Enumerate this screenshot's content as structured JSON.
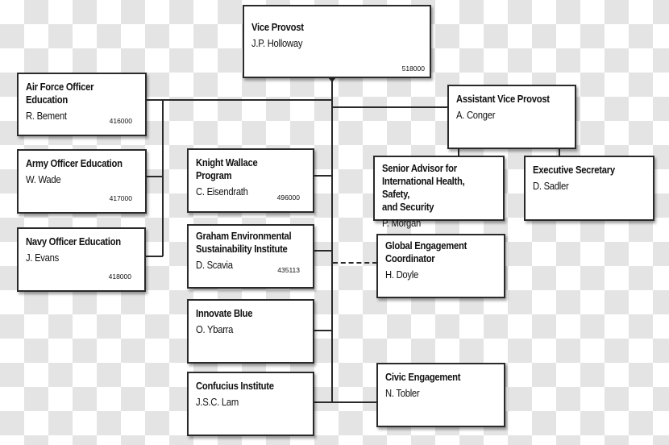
{
  "chart": {
    "vice_provost": {
      "title": "Vice Provost",
      "name": "J.P. Holloway",
      "code": "518000"
    },
    "air_force": {
      "title": "Air Force Officer Education",
      "name": "R. Bement",
      "code": "416000"
    },
    "army": {
      "title": "Army Officer Education",
      "name": "W. Wade",
      "code": "417000"
    },
    "navy": {
      "title": "Navy Officer Education",
      "name": "J. Evans",
      "code": "418000"
    },
    "knight_wallace": {
      "title": "Knight Wallace Program",
      "name": "C. Eisendrath",
      "code": "496000"
    },
    "graham": {
      "title": "Graham Environmental\nSustainability Institute",
      "name": "D. Scavia",
      "code": "435113"
    },
    "innovate_blue": {
      "title": "Innovate Blue",
      "name": "O. Ybarra"
    },
    "confucius": {
      "title": "Confucius Institute",
      "name": "J.S.C. Lam"
    },
    "assistant_vp": {
      "title": "Assistant Vice Provost",
      "name": "A. Conger"
    },
    "senior_advisor": {
      "title": "Senior Advisor for\nInternational Health, Safety,\nand Security",
      "name": "P. Morgan"
    },
    "exec_secretary": {
      "title": "Executive Secretary",
      "name": "D. Sadler"
    },
    "global_engagement": {
      "title": "Global Engagement\nCoordinator",
      "name": "H. Doyle"
    },
    "civic_engagement": {
      "title": "Civic Engagement",
      "name": "N. Tobler"
    }
  }
}
